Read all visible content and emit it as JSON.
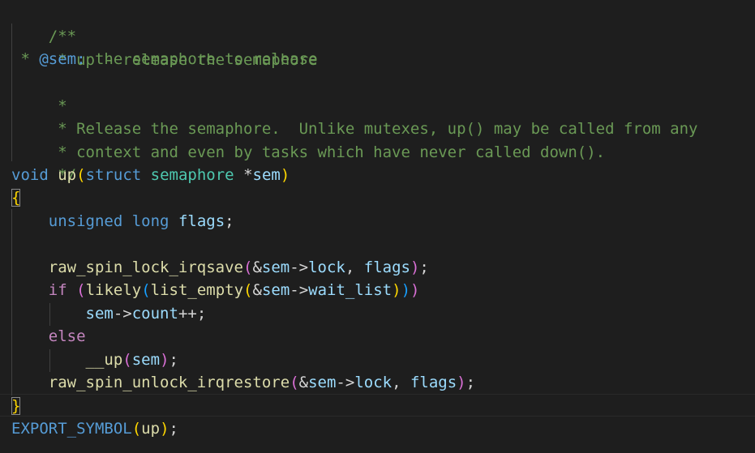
{
  "colors": {
    "background": "#1e1e1e",
    "comment": "#6a9955",
    "keyword": "#569cd6",
    "control": "#c586c0",
    "function": "#dcdcaa",
    "type": "#4ec9b0",
    "variable": "#9cdcfe",
    "bracket_level1": "#ffd700",
    "bracket_level2": "#da70d6",
    "bracket_level3": "#179fff"
  },
  "code": {
    "comment_open": "/**",
    "comment_line1": " * up - release the semaphore",
    "comment_line2_prefix": " * ",
    "comment_line2_tag": "@sem:",
    "comment_line2_text": " the semaphore to release",
    "comment_line3": " *",
    "comment_line4": " * Release the semaphore.  Unlike mutexes, up() may be called from any",
    "comment_line5": " * context and even by tasks which have never called down().",
    "comment_close": " */",
    "sig_void": "void",
    "sig_fn": "up",
    "sig_struct": "struct",
    "sig_type": "semaphore",
    "sig_star": "*",
    "sig_param": "sem",
    "brace_open": "{",
    "decl_type": "unsigned long",
    "decl_var": "flags",
    "lock_fn": "raw_spin_lock_irqsave",
    "lock_amp": "&",
    "lock_sem": "sem",
    "lock_arrow": "->",
    "lock_field": "lock",
    "lock_comma": ", ",
    "lock_flags": "flags",
    "if_kw": "if",
    "likely_fn": "likely",
    "list_empty_fn": "list_empty",
    "if_amp": "&",
    "if_sem": "sem",
    "if_arrow": "->",
    "if_field": "wait_list",
    "count_sem": "sem",
    "count_arrow": "->",
    "count_field": "count",
    "count_op": "++;",
    "else_kw": "else",
    "up_fn": "__up",
    "up_arg": "sem",
    "unlock_fn": "raw_spin_unlock_irqrestore",
    "unlock_amp": "&",
    "unlock_sem": "sem",
    "unlock_arrow": "->",
    "unlock_field": "lock",
    "unlock_comma": ", ",
    "unlock_flags": "flags",
    "brace_close": "}",
    "export_macro": "EXPORT_SYMBOL",
    "export_arg": "up",
    "semicolon": ";"
  }
}
